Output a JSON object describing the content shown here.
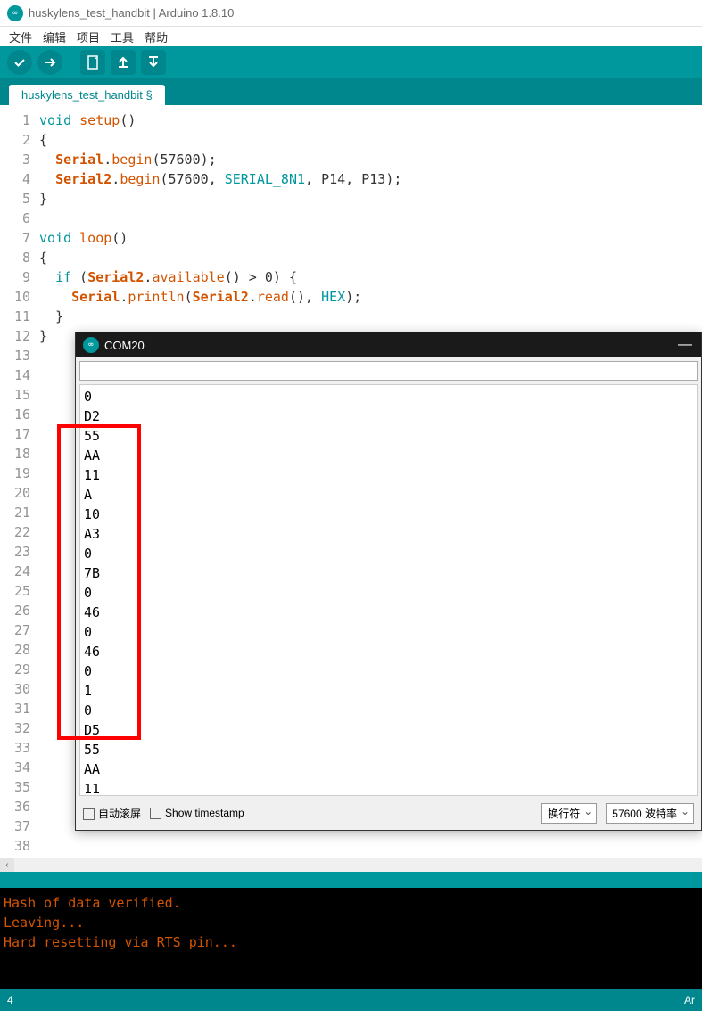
{
  "app": {
    "title": "huskylens_test_handbit | Arduino 1.8.10",
    "icon_label": "∞"
  },
  "menu": {
    "file": "文件",
    "edit": "编辑",
    "project": "项目",
    "tool": "工具",
    "help": "帮助"
  },
  "tab": {
    "active": "huskylens_test_handbit §"
  },
  "gutter": {
    "lines": [
      "1",
      "2",
      "3",
      "4",
      "5",
      "6",
      "7",
      "8",
      "9",
      "10",
      "11",
      "12",
      "13",
      "14",
      "15",
      "16",
      "17",
      "18",
      "19",
      "20",
      "21",
      "22",
      "23",
      "24",
      "25",
      "26",
      "27",
      "28",
      "29",
      "30",
      "31",
      "32",
      "33",
      "34",
      "35",
      "36",
      "37",
      "38"
    ]
  },
  "code": {
    "l1a": "void",
    "l1b": " ",
    "l1c": "setup",
    "l1d": "()",
    "l2": "{",
    "l3a": "  ",
    "l3b": "Serial",
    "l3c": ".",
    "l3d": "begin",
    "l3e": "(57600);",
    "l4a": "  ",
    "l4b": "Serial2",
    "l4c": ".",
    "l4d": "begin",
    "l4e": "(57600, ",
    "l4f": "SERIAL_8N1",
    "l4g": ", P14, P13);",
    "l5": "}",
    "l7a": "void",
    "l7b": " ",
    "l7c": "loop",
    "l7d": "()",
    "l8": "{",
    "l9a": "  ",
    "l9b": "if",
    "l9c": " (",
    "l9d": "Serial2",
    "l9e": ".",
    "l9f": "available",
    "l9g": "() > 0) {",
    "l10a": "    ",
    "l10b": "Serial",
    "l10c": ".",
    "l10d": "println",
    "l10e": "(",
    "l10f": "Serial2",
    "l10g": ".",
    "l10h": "read",
    "l10i": "(), ",
    "l10j": "HEX",
    "l10k": ");",
    "l11": "  }",
    "l12": "}"
  },
  "console": {
    "l1": "Hash of data verified.",
    "l2": "",
    "l3": "Leaving...",
    "l4": "Hard resetting via RTS pin..."
  },
  "status": {
    "left": "4",
    "right": "Ar"
  },
  "serial": {
    "title": "COM20",
    "icon_label": "∞",
    "output": [
      "0",
      "D2",
      "55",
      "AA",
      "11",
      "A",
      "10",
      "A3",
      "0",
      "7B",
      "0",
      "46",
      "0",
      "46",
      "0",
      "1",
      "0",
      "D5",
      "55",
      "AA",
      "11"
    ],
    "footer": {
      "autoscroll": "自动滚屏",
      "timestamp": "Show timestamp",
      "line_ending": "换行符",
      "baud": "57600 波特率"
    }
  }
}
